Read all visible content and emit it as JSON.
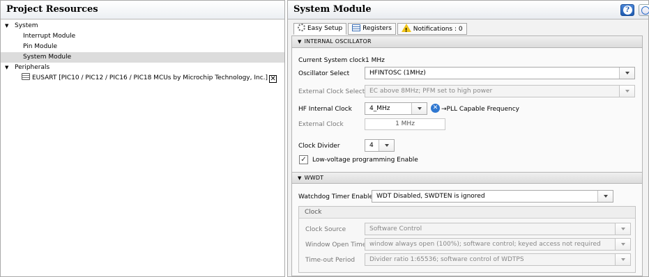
{
  "left": {
    "title": "Project Resources",
    "tree": [
      {
        "label": "System",
        "expandable": true
      },
      {
        "label": "Interrupt Module"
      },
      {
        "label": "Pin Module"
      },
      {
        "label": "System Module",
        "selected": true
      },
      {
        "label": "Peripherals",
        "expandable": true
      },
      {
        "label": "EUSART [PIC10 / PIC12 / PIC16 / PIC18 MCUs  by Microchip Technology, Inc.]",
        "close": "✕"
      }
    ]
  },
  "right": {
    "title": "System Module",
    "help": "?",
    "tabs": [
      {
        "label": "Easy Setup",
        "icon": "gear-icon"
      },
      {
        "label": "Registers",
        "icon": "registers-icon"
      },
      {
        "label": "Notifications : 0",
        "icon": "warning-icon"
      }
    ],
    "internal_osc": {
      "header": "INTERNAL OSCILLATOR",
      "current_clock_label": "Current System clock",
      "current_clock_value": "1 MHz",
      "osc_select_label": "Oscillator Select",
      "osc_select_value": "HFINTOSC (1MHz)",
      "ext_clock_select_label": "External Clock Select",
      "ext_clock_select_value": "EC above 8MHz; PFM set to high power",
      "hf_internal_label": "HF Internal Clock",
      "hf_internal_value": "4_MHz",
      "pll_text": "→PLL Capable Frequency",
      "ext_clock_label": "External Clock",
      "ext_clock_value": "1 MHz",
      "clock_divider_label": "Clock Divider",
      "clock_divider_value": "4",
      "lvp_label": "Low-voltage programming Enable",
      "lvp_checked": true
    },
    "wwdt": {
      "header": "WWDT",
      "wdt_enable_label": "Watchdog Timer Enable",
      "wdt_enable_value": "WDT Disabled, SWDTEN is ignored",
      "clock_group_title": "Clock",
      "clock_source_label": "Clock Source",
      "clock_source_value": "Software Control",
      "window_open_label": "Window Open Time",
      "window_open_value": "window always open (100%); software control; keyed access not required",
      "timeout_label": "Time-out Period",
      "timeout_value": "Divider ratio 1:65536; software control of WDTPS"
    }
  }
}
